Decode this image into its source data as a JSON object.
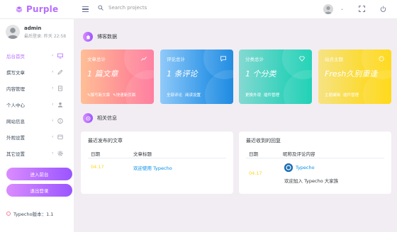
{
  "brand": {
    "name": "Purple"
  },
  "search": {
    "placeholder": "Search projects"
  },
  "profile": {
    "name": "admin",
    "last_login": "最后登录: 昨天 22:58"
  },
  "sidebar": {
    "items": [
      {
        "label": "后台首页",
        "icon": "monitor-icon"
      },
      {
        "label": "撰写文章",
        "icon": "pencil-icon"
      },
      {
        "label": "内容管理",
        "icon": "pages-icon"
      },
      {
        "label": "个人中心",
        "icon": "user-icon"
      },
      {
        "label": "网站信息",
        "icon": "info-icon"
      },
      {
        "label": "外观设置",
        "icon": "palette-icon"
      },
      {
        "label": "其它设置",
        "icon": "gear-icon"
      }
    ],
    "enter_front": "进入前台",
    "logout": "退出登录",
    "version": "Typecho版本：1.1"
  },
  "stats_section": {
    "title": "博客数据"
  },
  "cards": [
    {
      "title": "文章总计",
      "value": "1 篇文章",
      "links": [
        "✎撰写新文章",
        "✎快速新页面"
      ],
      "color": "#fe7096"
    },
    {
      "title": "评论总计",
      "value": "1 条评论",
      "links": [
        "全部评论",
        "阅读设置"
      ],
      "color": "#047edf"
    },
    {
      "title": "分类总计",
      "value": "1 个分类",
      "links": [
        "更换外观",
        "插件管理"
      ],
      "color": "#07cdae"
    },
    {
      "title": "站点主题",
      "value": "Fresh久别重逢",
      "links": [
        "主题编辑",
        "插件管理"
      ],
      "color": "#ffd500"
    }
  ],
  "info_section": {
    "title": "相关信息"
  },
  "recent_posts": {
    "title": "最近发布的文章",
    "col_date": "日期",
    "col_title": "文章标题",
    "rows": [
      {
        "date": "04.17",
        "title": "欢迎使用 Typecho"
      }
    ]
  },
  "recent_comments": {
    "title": "最近收到的回复",
    "col_date": "日期",
    "col_content": "昵称及评论内容",
    "rows": [
      {
        "date": "04.17",
        "author": "Typecho",
        "text": "欢迎加入 Typecho 大家族"
      }
    ]
  }
}
